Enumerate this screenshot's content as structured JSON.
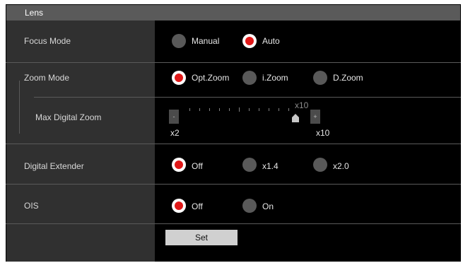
{
  "panel": {
    "title": "Lens"
  },
  "focus_mode": {
    "label": "Focus Mode",
    "options": [
      "Manual",
      "Auto"
    ],
    "selected": "Auto"
  },
  "zoom_mode": {
    "label": "Zoom Mode",
    "options": [
      "Opt.Zoom",
      "i.Zoom",
      "D.Zoom"
    ],
    "selected": "Opt.Zoom"
  },
  "max_digital_zoom": {
    "label": "Max Digital Zoom",
    "minus_label": "-",
    "plus_label": "+",
    "current_value_label": "x10",
    "min_label": "x2",
    "max_label": "x10",
    "value_fraction": 1.0
  },
  "digital_extender": {
    "label": "Digital Extender",
    "options": [
      "Off",
      "x1.4",
      "x2.0"
    ],
    "selected": "Off"
  },
  "ois": {
    "label": "OIS",
    "options": [
      "Off",
      "On"
    ],
    "selected": "Off"
  },
  "set_button": {
    "label": "Set"
  },
  "colors": {
    "selected_dot": "#e01818",
    "header": "#5a5a5a",
    "left_column": "#303030"
  }
}
